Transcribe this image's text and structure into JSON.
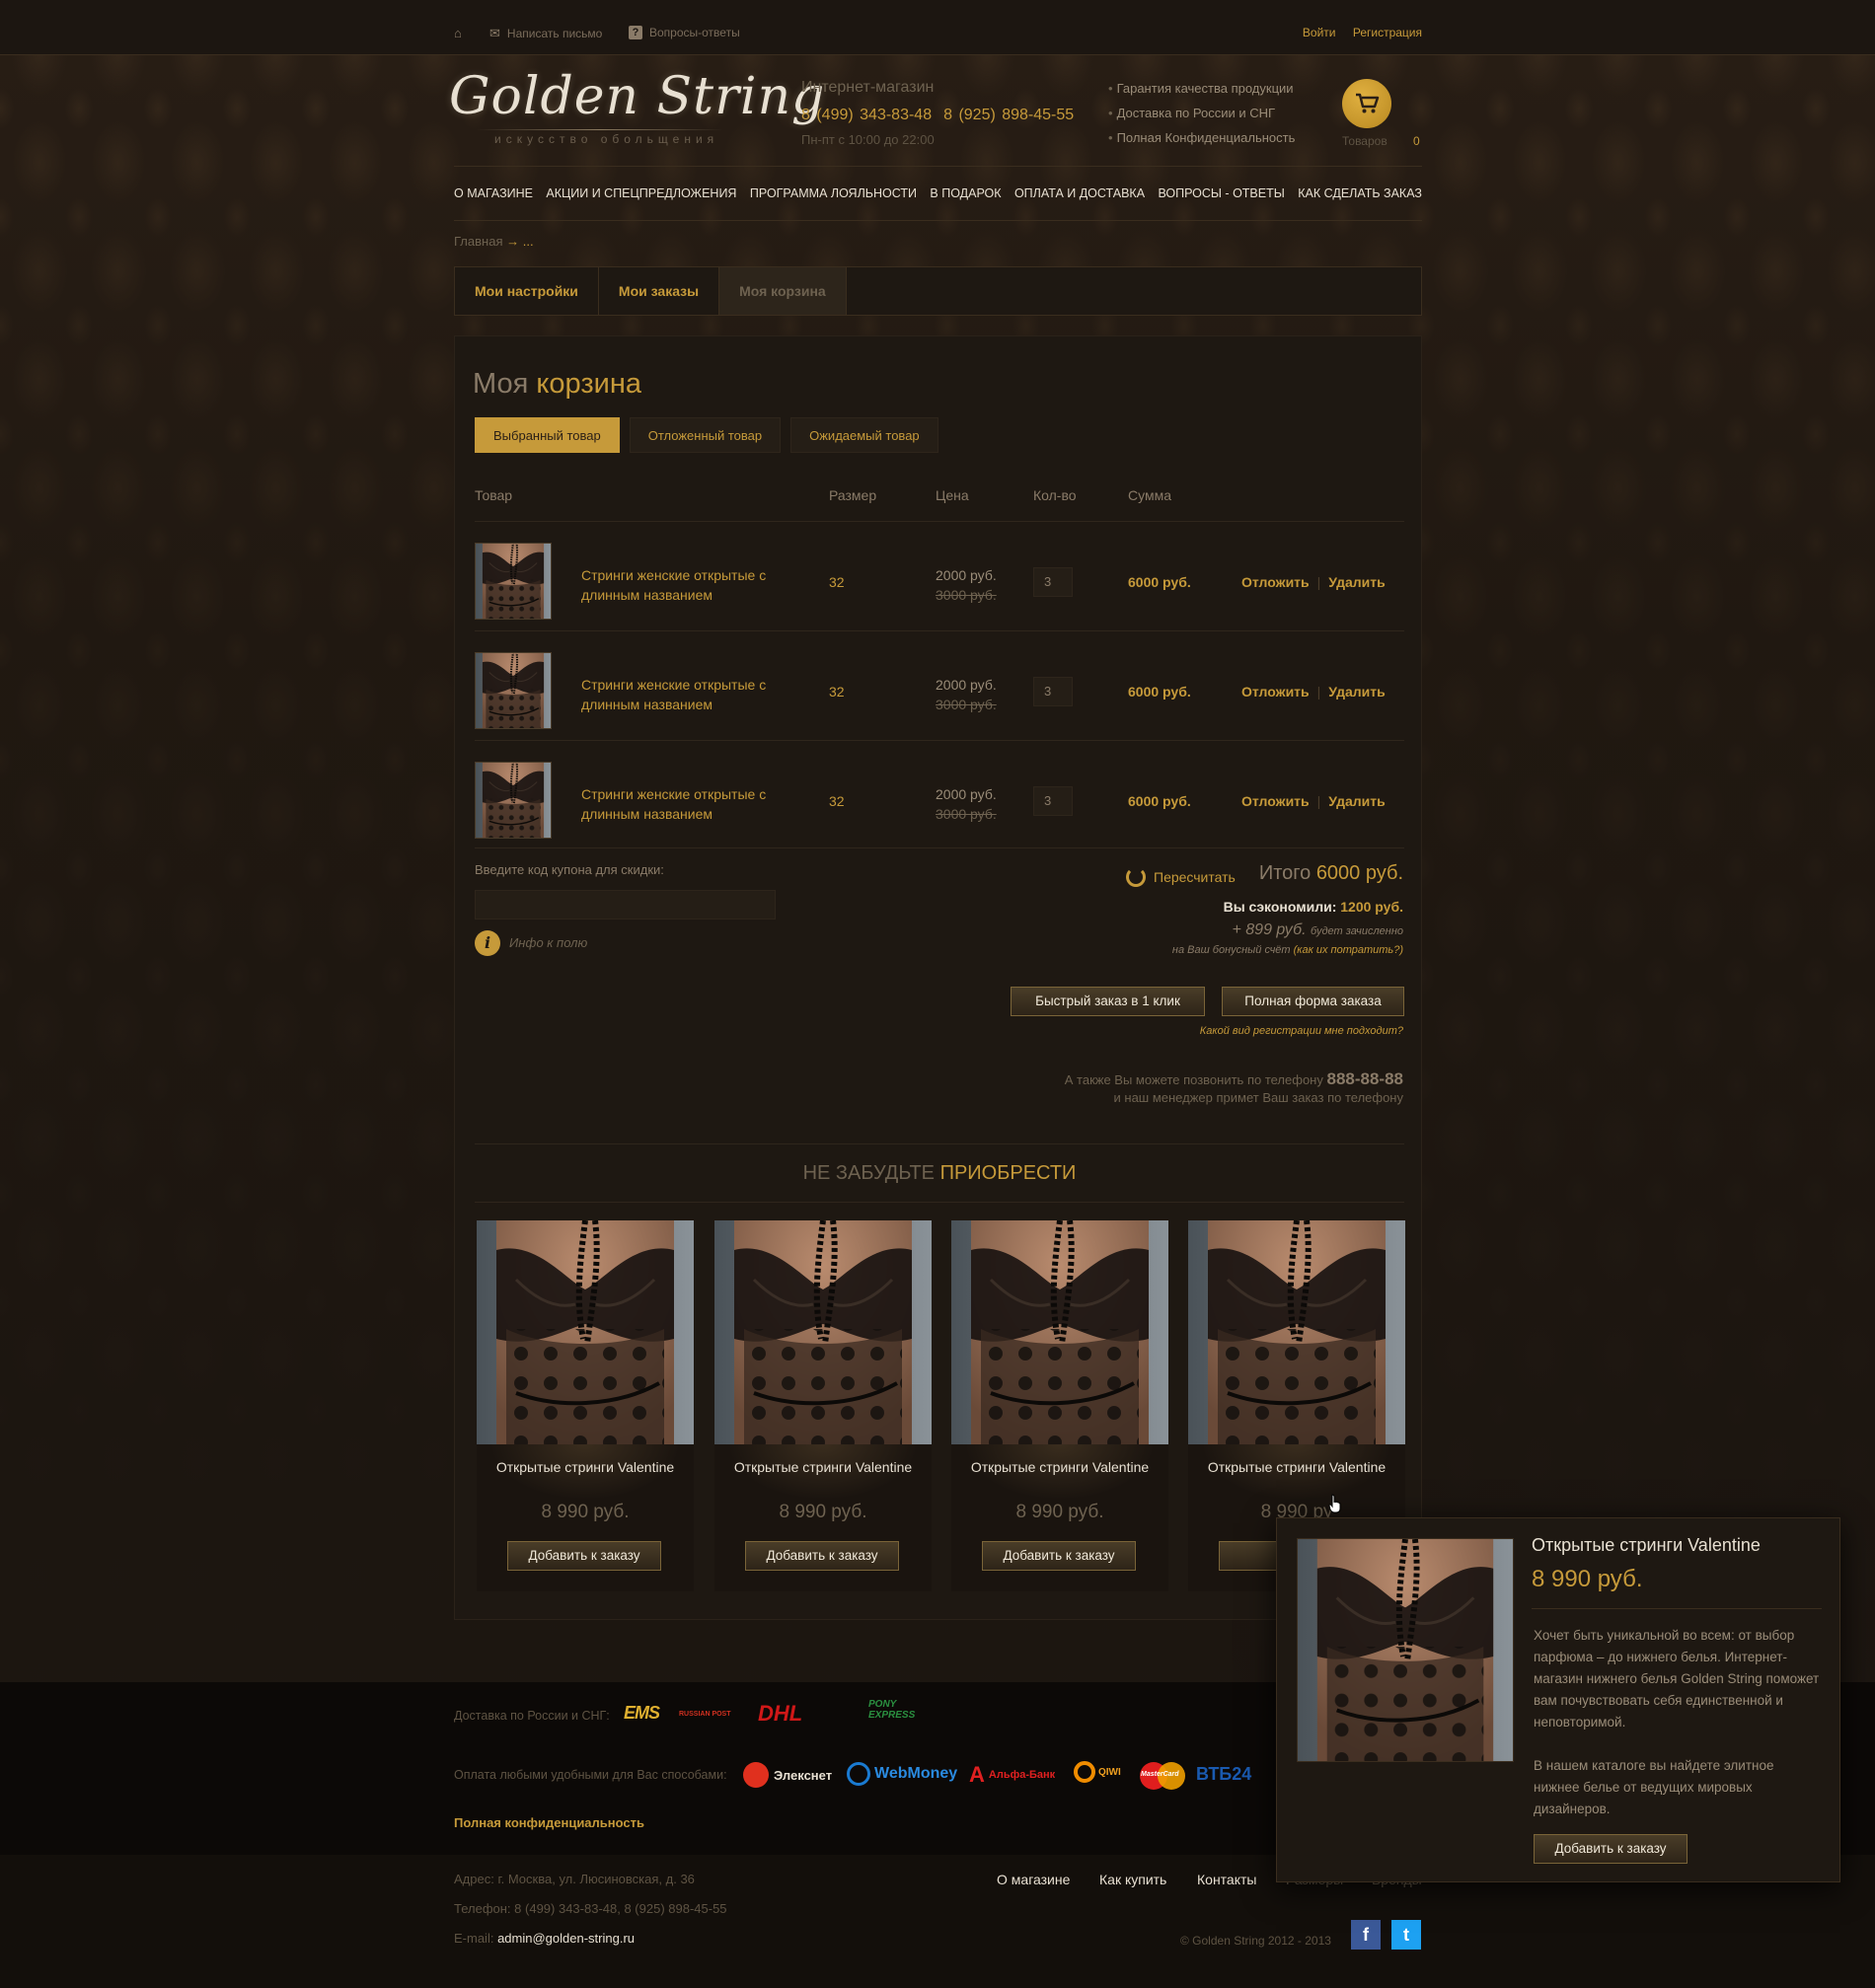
{
  "topbar": {
    "write_letter": "Написать письмо",
    "faq": "Вопросы-ответы",
    "login": "Войти",
    "register": "Регистрация"
  },
  "logo": {
    "name": "Golden String",
    "tagline": "искусство обольщения"
  },
  "contact": {
    "label": "Интернет-магазин",
    "phone1": "8 (499) 343-83-48",
    "phone2": "8 (925) 898-45-55",
    "hours": "Пн-пт с 10:00 до 22:00"
  },
  "perks": [
    "Гарантия качества продукции",
    "Доставка по России и СНГ",
    "Полная Конфиденциальность"
  ],
  "cart": {
    "label": "Товаров",
    "count": "0",
    "icon": "cart-icon"
  },
  "nav": [
    "О магазине",
    "Акции и спецпредложения",
    "Программа лояльности",
    "В подарок",
    "Оплата и доставка",
    "Вопросы - ответы",
    "Как сделать заказ"
  ],
  "breadcrumb": {
    "home": "Главная",
    "arrow": "→",
    "current": "..."
  },
  "account_tabs": [
    {
      "label": "Мои настройки",
      "active": false
    },
    {
      "label": "Мои заказы",
      "active": false
    },
    {
      "label": "Моя корзина",
      "active": true
    }
  ],
  "cart_page": {
    "title_a": "Моя",
    "title_b": "корзина",
    "subtabs": [
      "Выбранный товар",
      "Отложенный товар",
      "Ожидаемый товар"
    ],
    "columns": {
      "product": "Товар",
      "size": "Размер",
      "price": "Цена",
      "qty": "Кол-во",
      "sum": "Сумма"
    },
    "rows": [
      {
        "name": "Стринги женские открытые с длинным названием",
        "size": "32",
        "price": "2000 руб.",
        "old_price": "3000 руб.",
        "qty": "3",
        "sum": "6000 руб.",
        "postpone": "Отложить",
        "delete": "Удалить"
      },
      {
        "name": "Стринги женские открытые с длинным названием",
        "size": "32",
        "price": "2000 руб.",
        "old_price": "3000 руб.",
        "qty": "3",
        "sum": "6000 руб.",
        "postpone": "Отложить",
        "delete": "Удалить"
      },
      {
        "name": "Стринги женские открытые с длинным названием",
        "size": "32",
        "price": "2000 руб.",
        "old_price": "3000 руб.",
        "qty": "3",
        "sum": "6000 руб.",
        "postpone": "Отложить",
        "delete": "Удалить"
      }
    ],
    "coupon_label": "Введите код купона для скидки:",
    "coupon_value": "",
    "info_text": "Инфо к полю",
    "recalc": "Пересчитать",
    "total_label": "Итого",
    "total_value": "6000 руб.",
    "saved_label": "Вы сэкономили:",
    "saved_value": "1200 руб.",
    "bonus_value": "+ 899 руб.",
    "bonus_note": "будет зачисленно",
    "bonus_line2": "на Ваш  бонусный счёт",
    "bonus_link": "(как их потратить?)",
    "quick_order": "Быстрый заказ в 1 клик",
    "full_order": "Полная форма заказа",
    "reg_question": "Какой вид регистрации мне подходит?",
    "phone_note": "А также Вы можете позвонить по телефону",
    "phone_number": "888-88-88",
    "phone_note2": "и наш менеджер примет Ваш заказ по телефону"
  },
  "recommend": {
    "title_a": "Не забудьте",
    "title_b": "приобрести",
    "products": [
      {
        "title": "Открытые стринги Valentine",
        "price": "8 990 руб.",
        "button": "Добавить к заказу"
      },
      {
        "title": "Открытые стринги Valentine",
        "price": "8 990 руб.",
        "button": "Добавить к заказу"
      },
      {
        "title": "Открытые стринги Valentine",
        "price": "8 990 руб.",
        "button": "Добавить к заказу"
      },
      {
        "title": "Открытые стринги Valentine",
        "price": "8 990 ру",
        "button": "Добав"
      }
    ]
  },
  "popup": {
    "title": "Открытые стринги Valentine",
    "price": "8 990 руб.",
    "desc1": "Хочет быть уникальной во всем: от выбор парфюма – до нижнего белья. Интернет-магазин нижнего белья Golden String поможет вам почувствовать себя единственной и неповторимой.",
    "desc2": "В нашем каталоге вы найдете элитное нижнее белье от ведущих мировых дизайнеров.",
    "button": "Добавить к заказу"
  },
  "footer": {
    "delivery_label": "Доставка по России и СНГ:",
    "delivery_logos": [
      "EMS",
      "RUSSIAN POST",
      "DHL",
      "PONY",
      "EXPRESS"
    ],
    "payment_label": "Оплата любыми удобными для Вас способами:",
    "payment_logos": [
      "Элекснет",
      "WebMoney",
      "Альфа-Банк",
      "QIWI",
      "MasterCard",
      "ВТБ24"
    ],
    "privacy": "Полная конфиденциальность",
    "address_label": "Адрес:",
    "address": "г. Москва, ул. Люсиновская, д. 36",
    "phone_label": "Телефон:",
    "phone": "8 (499) 343-83-48, 8 (925) 898-45-55",
    "email_label": "E-mail:",
    "email": "admin@golden-string.ru",
    "nav": [
      "О магазине",
      "Как купить",
      "Контакты",
      "Размеры",
      "Бренды"
    ],
    "copyright": "© Golden String  2012 - 2013"
  },
  "colors": {
    "accent": "#c69a3a",
    "bg": "#1e1812"
  }
}
